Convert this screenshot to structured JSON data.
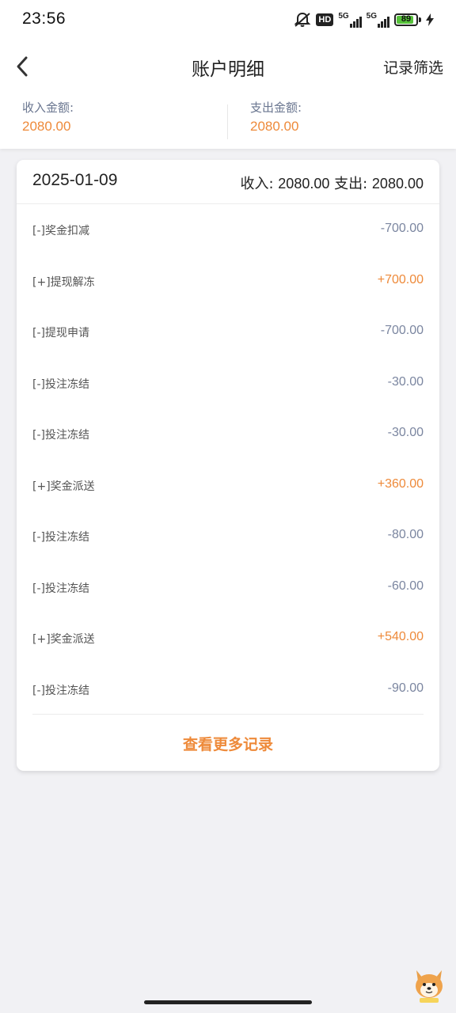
{
  "status_bar": {
    "time": "23:56",
    "hd_label": "HD",
    "network1_label": "5G",
    "network2_label": "5G",
    "battery_level": "89"
  },
  "nav": {
    "title": "账户明细",
    "filter_label": "记录筛选"
  },
  "summary": {
    "income_label": "收入金额:",
    "income_value": "2080.00",
    "expense_label": "支出金额:",
    "expense_value": "2080.00"
  },
  "day_group": {
    "date": "2025-01-09",
    "income_label": "收入:",
    "income_value": "2080.00",
    "expense_label": "支出:",
    "expense_value": "2080.00",
    "records": [
      {
        "desc": "[-]奖金扣减",
        "amount": "-700.00",
        "sign": "neg"
      },
      {
        "desc": "[+]提现解冻",
        "amount": "+700.00",
        "sign": "pos"
      },
      {
        "desc": "[-]提现申请",
        "amount": "-700.00",
        "sign": "neg"
      },
      {
        "desc": "[-]投注冻结",
        "amount": "-30.00",
        "sign": "neg"
      },
      {
        "desc": "[-]投注冻结",
        "amount": "-30.00",
        "sign": "neg"
      },
      {
        "desc": "[+]奖金派送",
        "amount": "+360.00",
        "sign": "pos"
      },
      {
        "desc": "[-]投注冻结",
        "amount": "-80.00",
        "sign": "neg"
      },
      {
        "desc": "[-]投注冻结",
        "amount": "-60.00",
        "sign": "neg"
      },
      {
        "desc": "[+]奖金派送",
        "amount": "+540.00",
        "sign": "pos"
      },
      {
        "desc": "[-]投注冻结",
        "amount": "-90.00",
        "sign": "neg"
      }
    ],
    "more_label": "查看更多记录"
  },
  "colors": {
    "accent": "#ee8a3a",
    "negative": "#7b86a0",
    "background": "#f1f1f4"
  },
  "icons": {
    "back": "chevron-left-icon",
    "mute": "bell-off-icon",
    "mascot": "shiba-mascot-icon"
  }
}
